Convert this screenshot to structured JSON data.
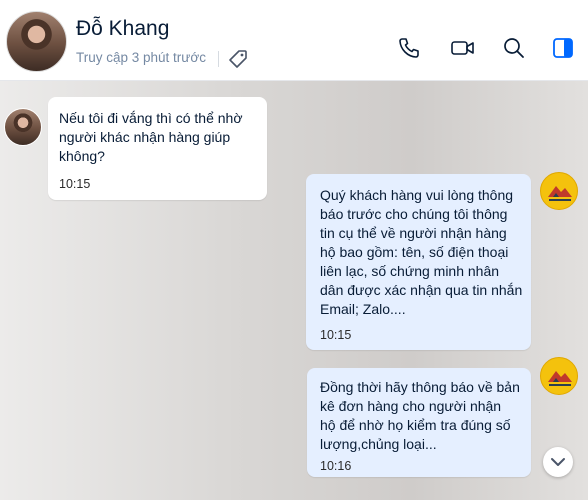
{
  "header": {
    "contact_name": "Đỗ Khang",
    "status": "Truy cập 3 phút trước",
    "icons": [
      "phone-icon",
      "video-call-icon",
      "search-icon",
      "sidebar-toggle-icon"
    ],
    "accent_color": "#0068ff"
  },
  "messages": [
    {
      "direction": "incoming",
      "text": "Nếu tôi đi vắng thì có thể nhờ người khác nhận hàng giúp không?",
      "time": "10:15"
    },
    {
      "direction": "outgoing",
      "text": "Quý khách hàng vui lòng thông báo trước cho chúng tôi thông tin cụ thể về người nhận hàng hộ bao gồm: tên, số điện thoại liên lạc, số chứng minh nhân dân được xác nhận qua tin nhắn Email; Zalo....",
      "time": "10:15"
    },
    {
      "direction": "outgoing",
      "text": "Đồng thời hãy thông báo về bản kê đơn hàng cho người nhận hộ để nhờ họ kiểm tra đúng số lượng,chủng loại...",
      "time": "10:16"
    }
  ],
  "colors": {
    "incoming_bubble": "#ffffff",
    "outgoing_bubble": "#e5efff",
    "shop_avatar": "#f4c20d"
  }
}
